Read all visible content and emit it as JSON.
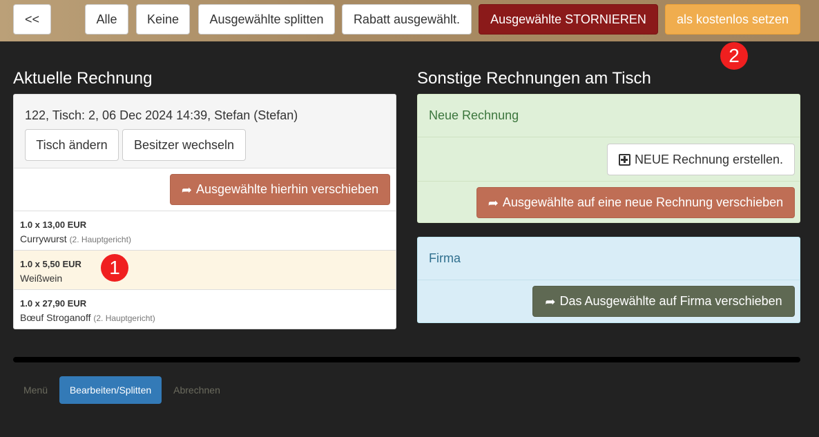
{
  "toolbar": {
    "back_label": "<<",
    "all_label": "Alle",
    "none_label": "Keine",
    "split_label": "Ausgewählte splitten",
    "discount_label": "Rabatt ausgewählt.",
    "cancel_label": "Ausgewählte STORNIEREN",
    "free_label": "als kostenlos setzen"
  },
  "badges": {
    "one": "1",
    "two": "2"
  },
  "current_bill": {
    "heading": "Aktuelle Rechnung",
    "info": "122, Tisch: 2, 06 Dec 2024 14:39, Stefan (Stefan)",
    "change_table_label": "Tisch ändern",
    "change_owner_label": "Besitzer wechseln",
    "move_here_label": "Ausgewählte hierhin verschieben",
    "items": [
      {
        "qty": "1.0 x 13,00 EUR",
        "name": "Currywurst",
        "note": "(2. Hauptgericht)",
        "selected": false
      },
      {
        "qty": "1.0 x 5,50 EUR",
        "name": "Weißwein",
        "note": "",
        "selected": true
      },
      {
        "qty": "1.0 x 27,90 EUR",
        "name": "Bœuf Stroganoff",
        "note": "(2. Hauptgericht)",
        "selected": false
      }
    ]
  },
  "other_bills": {
    "heading": "Sonstige Rechnungen am Tisch",
    "new_bill": {
      "title": "Neue Rechnung",
      "create_label": "NEUE Rechnung erstellen.",
      "move_new_label": "Ausgewählte auf eine neue Rechnung verschieben"
    },
    "company": {
      "title": "Firma",
      "move_company_label": "Das Ausgewählte auf Firma verschieben"
    }
  },
  "bottom_tabs": {
    "menu_label": "Menü",
    "edit_label": "Bearbeiten/Splitten",
    "checkout_label": "Abrechnen"
  },
  "colors": {
    "topbar": "#a88a62",
    "cancel": "#8b1a1a",
    "free": "#f0ad4e",
    "move": "#bf6e55",
    "company_move": "#5f6953",
    "active_tab": "#337ab7",
    "badge": "#f01f1f"
  },
  "icons": [
    "share-icon",
    "plus-square-icon"
  ]
}
